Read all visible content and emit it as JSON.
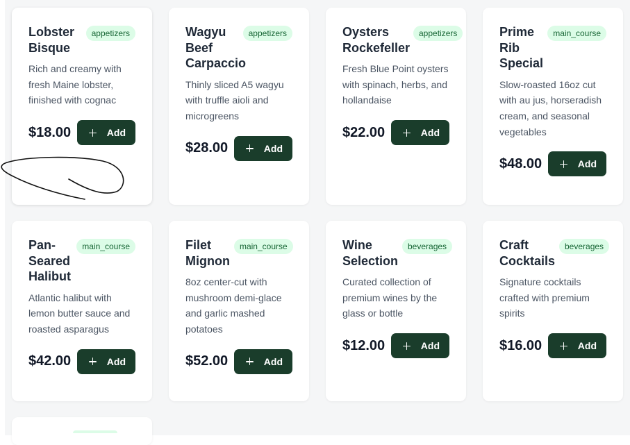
{
  "menu": {
    "items": [
      {
        "name": "Lobster Bisque",
        "category": "appetizers",
        "description": "Rich and creamy with fresh Maine lobster, finished with cognac",
        "price": "$18.00",
        "button_label": "Add"
      },
      {
        "name": "Wagyu Beef Carpaccio",
        "category": "appetizers",
        "description": "Thinly sliced A5 wagyu with truffle aioli and microgreens",
        "price": "$28.00",
        "button_label": "Add"
      },
      {
        "name": "Oysters Rockefeller",
        "category": "appetizers",
        "description": "Fresh Blue Point oysters with spinach, herbs, and hollandaise",
        "price": "$22.00",
        "button_label": "Add"
      },
      {
        "name": "Prime Rib Special",
        "category": "main_course",
        "description": "Slow-roasted 16oz cut with au jus, horseradish cream, and seasonal vegetables",
        "price": "$48.00",
        "button_label": "Add"
      },
      {
        "name": "Pan-Seared Halibut",
        "category": "main_course",
        "description": "Atlantic halibut with lemon butter sauce and roasted asparagus",
        "price": "$42.00",
        "button_label": "Add"
      },
      {
        "name": "Filet Mignon",
        "category": "main_course",
        "description": "8oz center-cut with mushroom demi-glace and garlic mashed potatoes",
        "price": "$52.00",
        "button_label": "Add"
      },
      {
        "name": "Wine Selection",
        "category": "beverages",
        "description": "Curated collection of premium wines by the glass or bottle",
        "price": "$12.00",
        "button_label": "Add"
      },
      {
        "name": "Craft Cocktails",
        "category": "beverages",
        "description": "Signature cocktails crafted with premium spirits",
        "price": "$16.00",
        "button_label": "Add"
      }
    ]
  },
  "colors": {
    "button_bg": "#1a3d2b",
    "tag_bg": "#dcfce7",
    "tag_text": "#166534",
    "page_bg": "#f5f6f7"
  },
  "icons": {
    "add_button_icon": "plus-icon"
  }
}
